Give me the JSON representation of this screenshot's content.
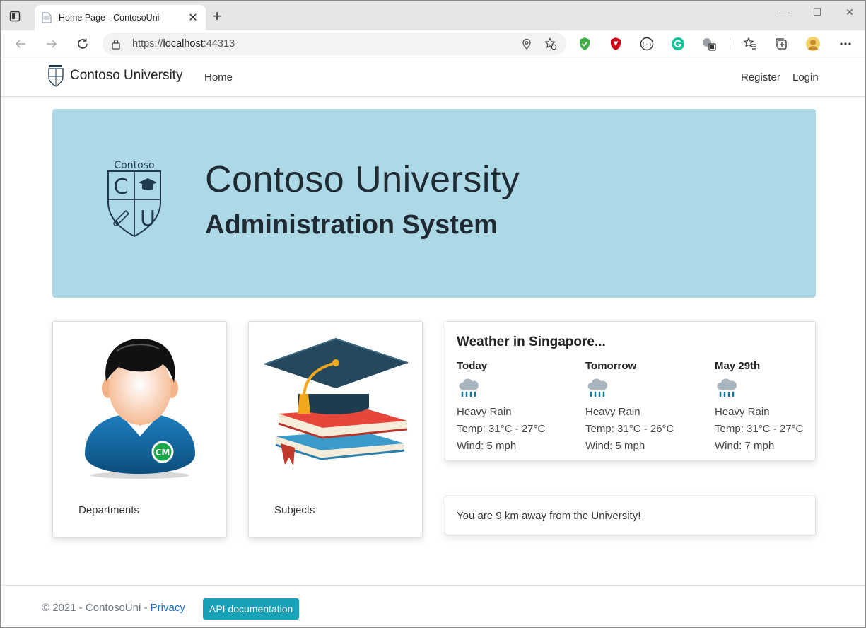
{
  "browser": {
    "tab_title": "Home Page - ContosoUni",
    "url_prefix": "https://",
    "url_host": "localhost",
    "url_rest": ":44313",
    "new_tab_label": "+",
    "close_tab_label": "✕",
    "window": {
      "minimize": "—",
      "maximize": "☐",
      "close": "✕"
    }
  },
  "nav": {
    "brand": "Contoso University",
    "home": "Home",
    "register": "Register",
    "login": "Login"
  },
  "hero": {
    "logo_top": "Contoso",
    "logo_c": "C",
    "logo_u": "U",
    "title": "Contoso University",
    "subtitle": "Administration System",
    "color": "#add8e6"
  },
  "cards": [
    {
      "label": "Departments",
      "icon": "person-avatar-icon"
    },
    {
      "label": "Subjects",
      "icon": "books-graduation-cap-icon"
    }
  ],
  "weather": {
    "title": "Weather in Singapore...",
    "days": [
      {
        "name": "Today",
        "condition": "Heavy Rain",
        "temp": "Temp: 31°C - 27°C",
        "wind": "Wind: 5 mph"
      },
      {
        "name": "Tomorrow",
        "condition": "Heavy Rain",
        "temp": "Temp: 31°C - 26°C",
        "wind": "Wind: 5 mph"
      },
      {
        "name": "May 29th",
        "condition": "Heavy Rain",
        "temp": "Temp: 31°C - 27°C",
        "wind": "Wind: 7 mph"
      }
    ]
  },
  "distance": "You are 9 km away from the University!",
  "footer": {
    "copyright": "© 2021 - ContosoUni - ",
    "privacy": "Privacy",
    "api_button": "API documentation",
    "api_color": "#17a2b8"
  }
}
